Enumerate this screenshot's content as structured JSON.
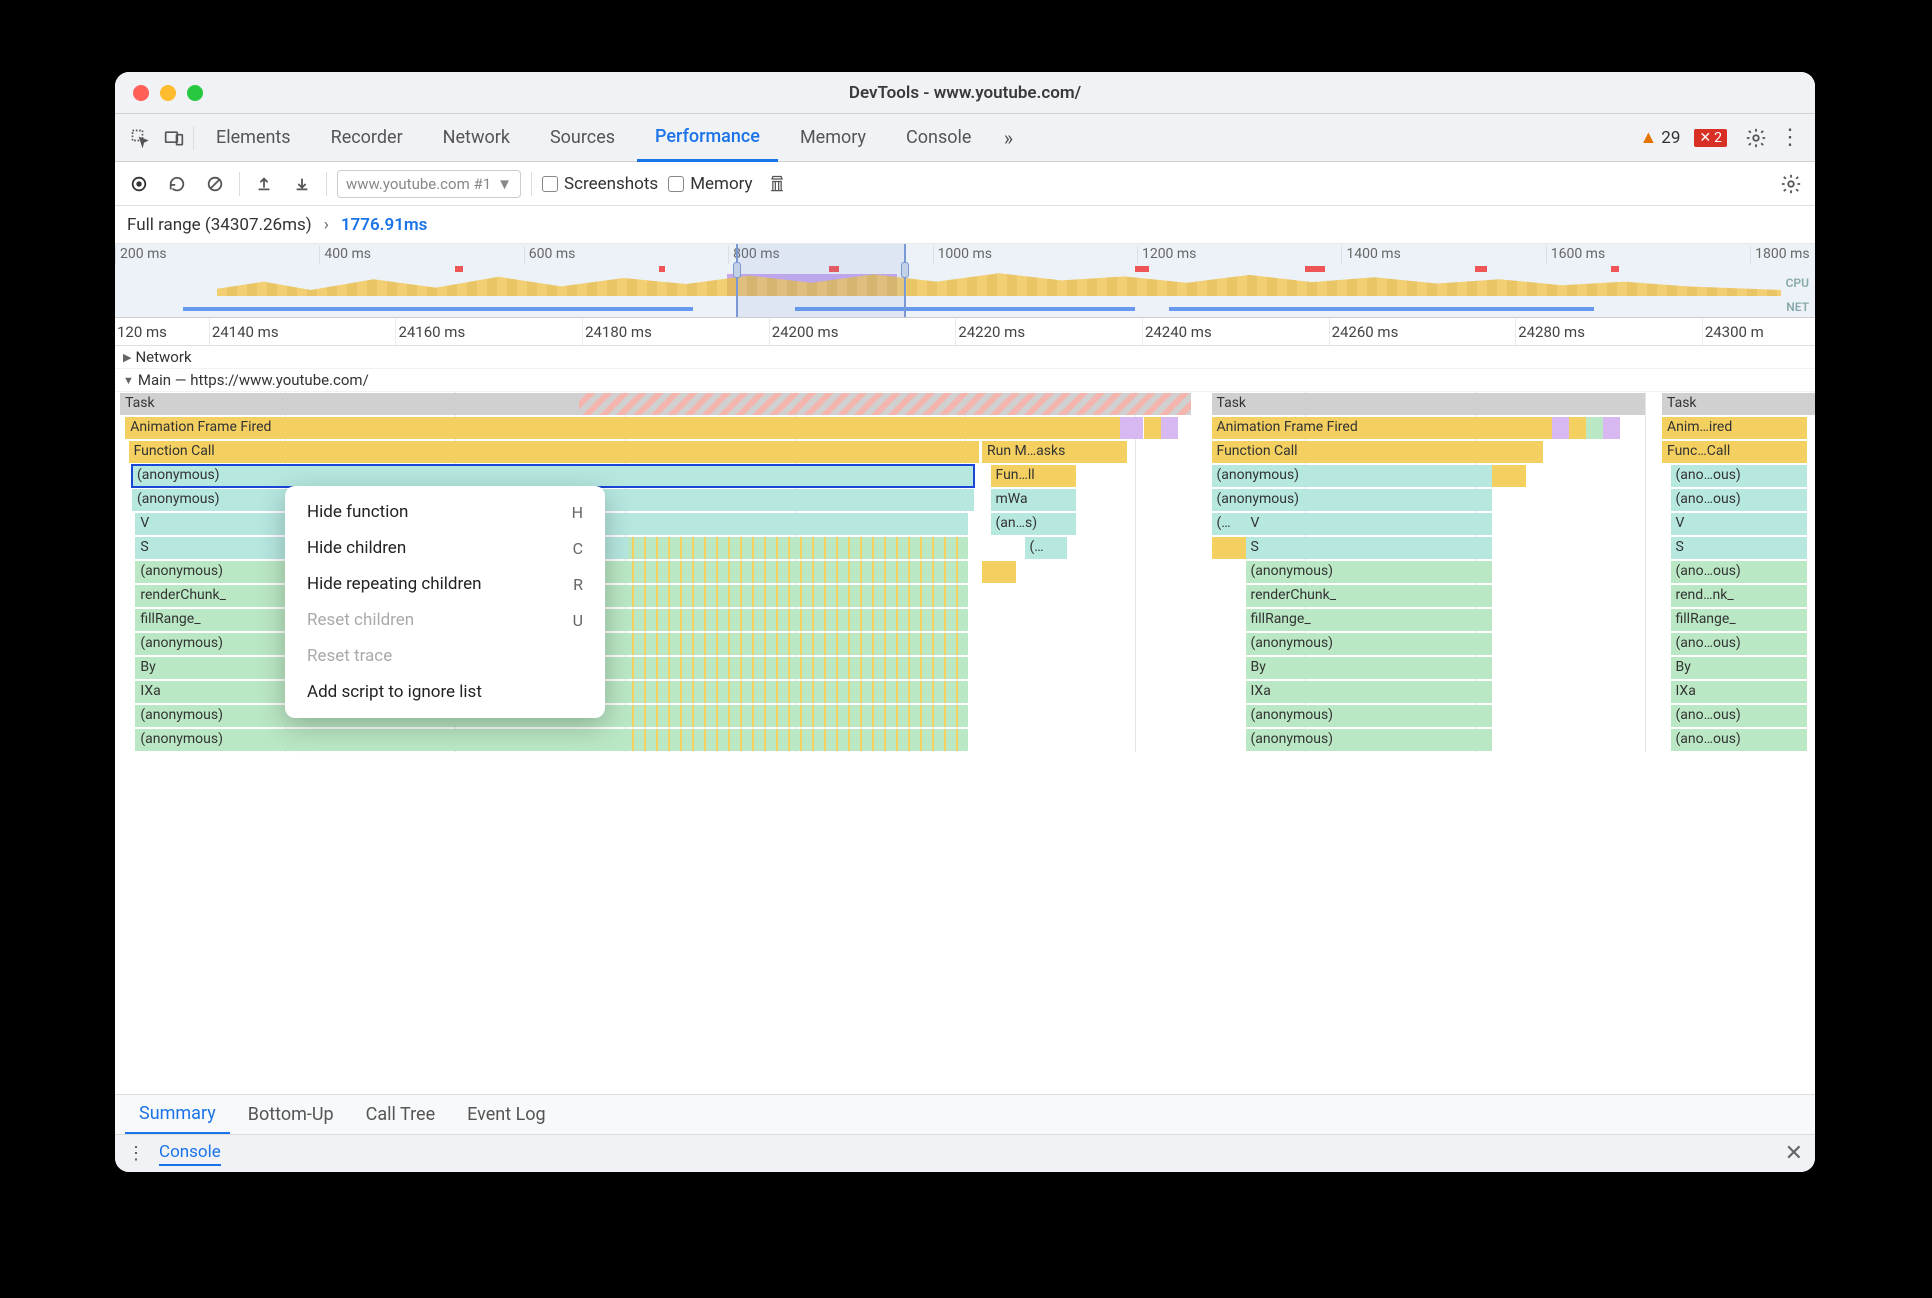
{
  "window": {
    "title": "DevTools - www.youtube.com/"
  },
  "tabs": {
    "items": [
      "Elements",
      "Recorder",
      "Network",
      "Sources",
      "Performance",
      "Memory",
      "Console"
    ],
    "active": "Performance",
    "warn_count": "29",
    "error_count": "2"
  },
  "toolbar": {
    "recording_select": "www.youtube.com #1",
    "screenshots": "Screenshots",
    "memory": "Memory"
  },
  "range": {
    "full": "Full range (34307.26ms)",
    "selected": "1776.91ms"
  },
  "overview_ticks": [
    "200 ms",
    "400 ms",
    "600 ms",
    "800 ms",
    "1000 ms",
    "1200 ms",
    "1400 ms",
    "1600 ms",
    "1800 ms"
  ],
  "overview_labels": {
    "cpu": "CPU",
    "net": "NET"
  },
  "detail_ticks": [
    "120 ms",
    "24140 ms",
    "24160 ms",
    "24180 ms",
    "24200 ms",
    "24220 ms",
    "24240 ms",
    "24260 ms",
    "24280 ms",
    "24300 m"
  ],
  "tracks": {
    "network": "Network",
    "main": "Main — https://www.youtube.com/"
  },
  "flame": {
    "task": "Task",
    "anim": "Animation Frame Fired",
    "anim3": "Anim…ired",
    "fn": "Function Call",
    "fn3": "Func…Call",
    "anon": "(anonymous)",
    "anon_short": "(ano…ous)",
    "run": "Run M…asks",
    "funll": "Fun…ll",
    "mwa": "mWa",
    "ans": "(an…s)",
    "dots": "(…",
    "ellipsis": "(…",
    "v": "V",
    "s": "S",
    "render": "renderChunk_",
    "render3": "rend…nk_",
    "fill": "fillRange_",
    "by": "By",
    "ixa": "IXa"
  },
  "context_menu": {
    "items": [
      {
        "label": "Hide function",
        "key": "H",
        "disabled": false
      },
      {
        "label": "Hide children",
        "key": "C",
        "disabled": false
      },
      {
        "label": "Hide repeating children",
        "key": "R",
        "disabled": false
      },
      {
        "label": "Reset children",
        "key": "U",
        "disabled": true
      },
      {
        "label": "Reset trace",
        "key": "",
        "disabled": true
      },
      {
        "label": "Add script to ignore list",
        "key": "",
        "disabled": false
      }
    ]
  },
  "bottom_tabs": [
    "Summary",
    "Bottom-Up",
    "Call Tree",
    "Event Log"
  ],
  "console": {
    "label": "Console"
  }
}
